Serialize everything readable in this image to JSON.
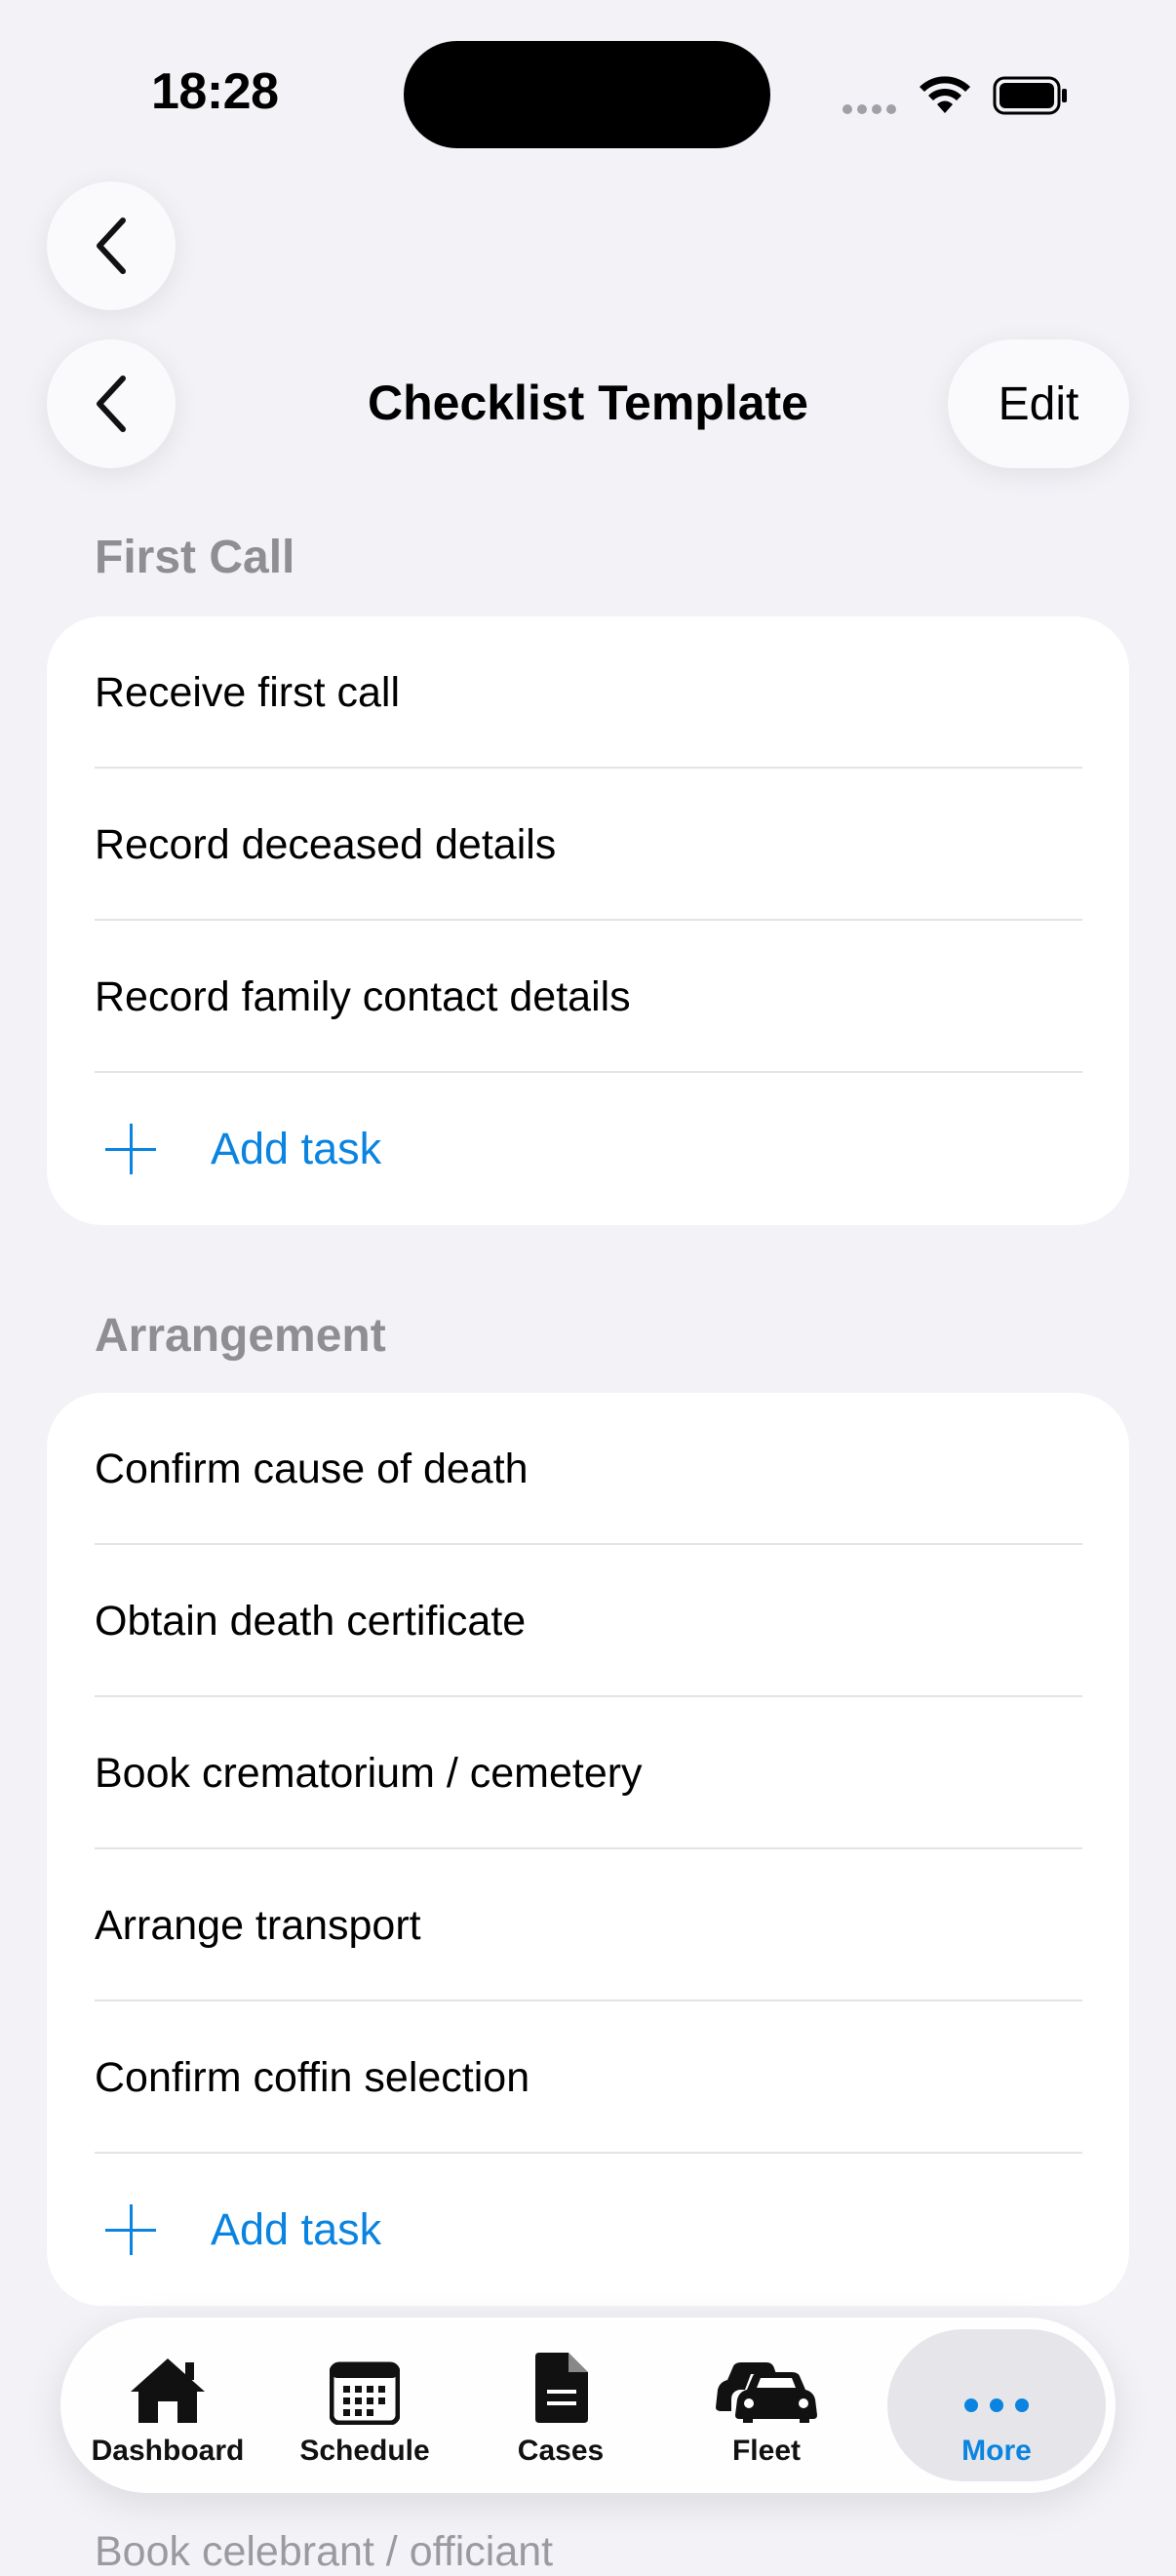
{
  "status_bar": {
    "time": "18:28"
  },
  "nav": {
    "title": "Checklist Template",
    "edit_label": "Edit"
  },
  "sections": [
    {
      "header": "First Call",
      "items": [
        "Receive first call",
        "Record deceased details",
        "Record family contact details"
      ],
      "add_label": "Add task"
    },
    {
      "header": "Arrangement",
      "items": [
        "Confirm cause of death",
        "Obtain death certificate",
        "Book crematorium / cemetery",
        "Arrange transport",
        "Confirm coffin selection"
      ],
      "add_label": "Add task"
    }
  ],
  "peek_item": "Book celebrant / officiant",
  "tabbar": {
    "tabs": [
      {
        "label": "Dashboard",
        "icon": "house-icon"
      },
      {
        "label": "Schedule",
        "icon": "calendar-icon"
      },
      {
        "label": "Cases",
        "icon": "document-icon"
      },
      {
        "label": "Fleet",
        "icon": "cars-icon"
      },
      {
        "label": "More",
        "icon": "ellipsis-icon",
        "selected": true
      }
    ]
  },
  "colors": {
    "accent": "#0a84e0",
    "background": "#f2f2f7",
    "section_header": "#8e8e93"
  }
}
